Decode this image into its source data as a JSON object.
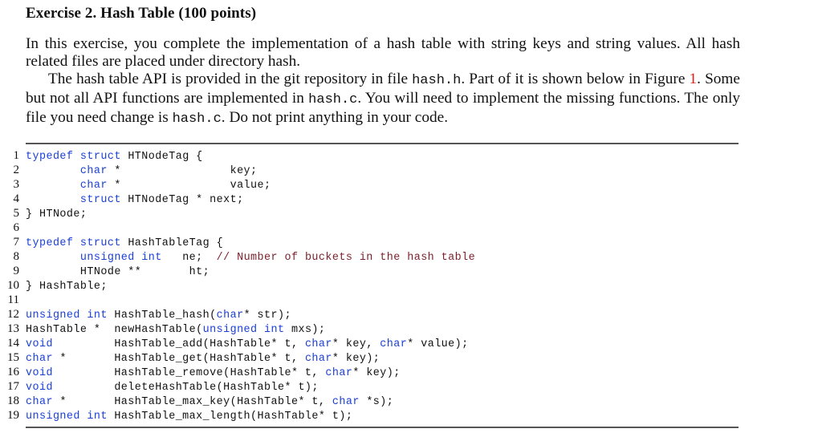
{
  "heading": "Exercise 2. Hash Table (100 points)",
  "paragraph1": "In this exercise, you complete the implementation of a hash table with string keys and string values. All hash related files are placed under directory hash.",
  "paragraph2": {
    "part1": "The hash table API is provided in the git repository in file ",
    "file1": "hash.h",
    "part2": ". Part of it is shown below in Figure ",
    "figure_ref": "1",
    "part3": ". Some but not all API functions are implemented in ",
    "file2": "hash.c",
    "part4": ". You will need to implement the missing functions. The only file you need change is ",
    "file3": "hash.c",
    "part5": ". Do not print anything in your code."
  },
  "colors": {
    "keyword": "#1a3fd6",
    "comment": "#7a1f2b",
    "reference": "#e0201b"
  },
  "code": {
    "lines": [
      {
        "n": "1",
        "segs": [
          [
            "kw",
            "typedef"
          ],
          [
            "tx",
            " "
          ],
          [
            "kw",
            "struct"
          ],
          [
            "tx",
            " HTNodeTag {"
          ]
        ]
      },
      {
        "n": "2",
        "segs": [
          [
            "tx",
            "        "
          ],
          [
            "kw",
            "char"
          ],
          [
            "tx",
            " *                key;"
          ]
        ]
      },
      {
        "n": "3",
        "segs": [
          [
            "tx",
            "        "
          ],
          [
            "kw",
            "char"
          ],
          [
            "tx",
            " *                value;"
          ]
        ]
      },
      {
        "n": "4",
        "segs": [
          [
            "tx",
            "        "
          ],
          [
            "kw",
            "struct"
          ],
          [
            "tx",
            " HTNodeTag * next;"
          ]
        ]
      },
      {
        "n": "5",
        "segs": [
          [
            "tx",
            "} HTNode;"
          ]
        ]
      },
      {
        "n": "6",
        "segs": []
      },
      {
        "n": "7",
        "segs": [
          [
            "kw",
            "typedef"
          ],
          [
            "tx",
            " "
          ],
          [
            "kw",
            "struct"
          ],
          [
            "tx",
            " HashTableTag {"
          ]
        ]
      },
      {
        "n": "8",
        "segs": [
          [
            "tx",
            "        "
          ],
          [
            "kw",
            "unsigned int"
          ],
          [
            "tx",
            "   ne;  "
          ],
          [
            "cm",
            "// Number of buckets in the hash table"
          ]
        ]
      },
      {
        "n": "9",
        "segs": [
          [
            "tx",
            "        HTNode **       ht;"
          ]
        ]
      },
      {
        "n": "10",
        "segs": [
          [
            "tx",
            "} HashTable;"
          ]
        ]
      },
      {
        "n": "11",
        "segs": []
      },
      {
        "n": "12",
        "segs": [
          [
            "kw",
            "unsigned int"
          ],
          [
            "tx",
            " HashTable_hash("
          ],
          [
            "kw",
            "char"
          ],
          [
            "tx",
            "* str);"
          ]
        ]
      },
      {
        "n": "13",
        "segs": [
          [
            "tx",
            "HashTable *  newHashTable("
          ],
          [
            "kw",
            "unsigned int"
          ],
          [
            "tx",
            " mxs);"
          ]
        ]
      },
      {
        "n": "14",
        "segs": [
          [
            "kw",
            "void"
          ],
          [
            "tx",
            "         HashTable_add(HashTable* t, "
          ],
          [
            "kw",
            "char"
          ],
          [
            "tx",
            "* key, "
          ],
          [
            "kw",
            "char"
          ],
          [
            "tx",
            "* value);"
          ]
        ]
      },
      {
        "n": "15",
        "segs": [
          [
            "kw",
            "char"
          ],
          [
            "tx",
            " *       HashTable_get(HashTable* t, "
          ],
          [
            "kw",
            "char"
          ],
          [
            "tx",
            "* key);"
          ]
        ]
      },
      {
        "n": "16",
        "segs": [
          [
            "kw",
            "void"
          ],
          [
            "tx",
            "         HashTable_remove(HashTable* t, "
          ],
          [
            "kw",
            "char"
          ],
          [
            "tx",
            "* key);"
          ]
        ]
      },
      {
        "n": "17",
        "segs": [
          [
            "kw",
            "void"
          ],
          [
            "tx",
            "         deleteHashTable(HashTable* t);"
          ]
        ]
      },
      {
        "n": "18",
        "segs": [
          [
            "kw",
            "char"
          ],
          [
            "tx",
            " *       HashTable_max_key(HashTable* t, "
          ],
          [
            "kw",
            "char"
          ],
          [
            "tx",
            " *s);"
          ]
        ]
      },
      {
        "n": "19",
        "segs": [
          [
            "kw",
            "unsigned int"
          ],
          [
            "tx",
            " HashTable_max_length(HashTable* t);"
          ]
        ]
      }
    ]
  }
}
